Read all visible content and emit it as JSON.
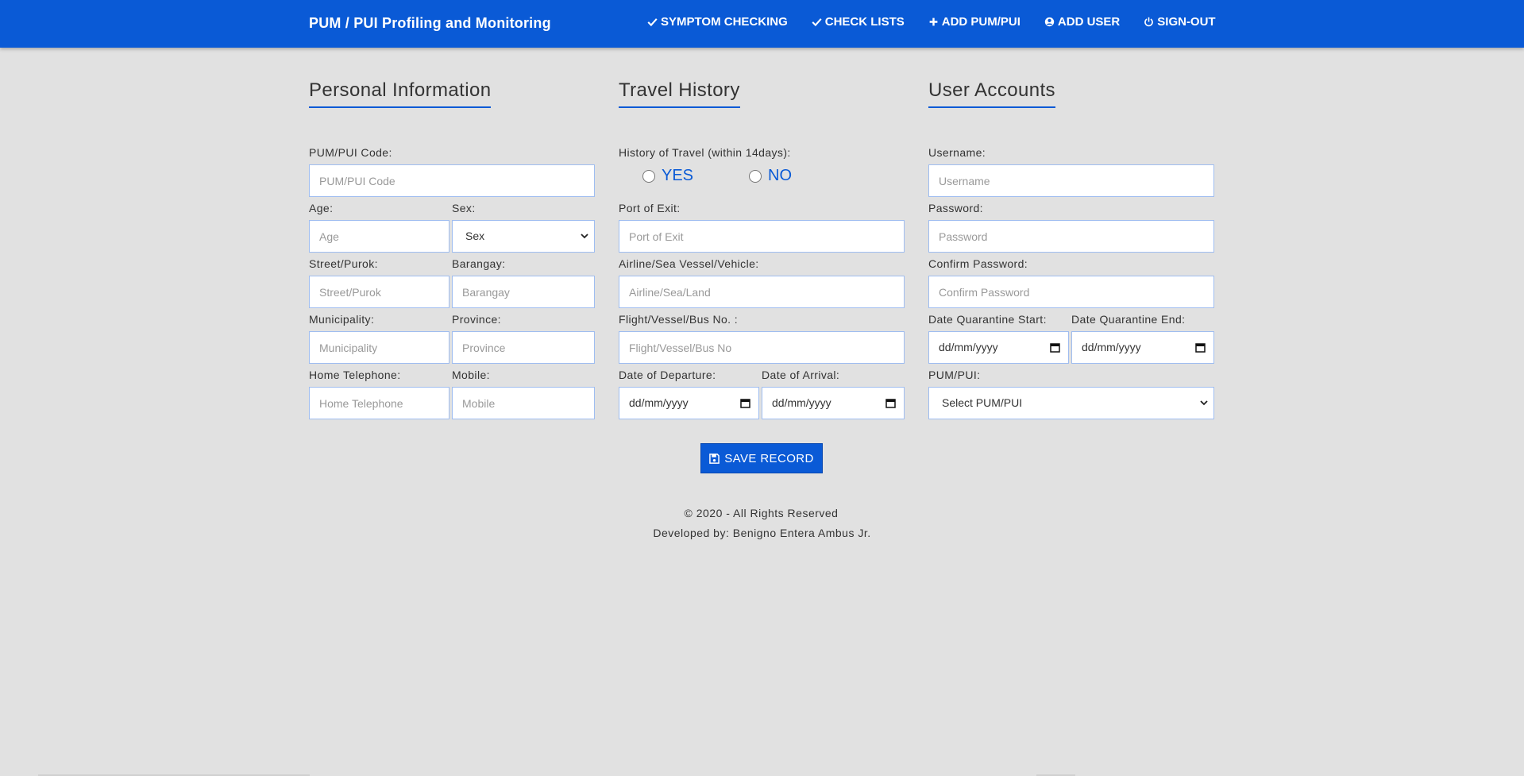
{
  "header": {
    "title": "PUM / PUI Profiling and Monitoring",
    "nav": [
      {
        "label": "SYMPTOM CHECKING",
        "icon": "check-icon"
      },
      {
        "label": "CHECK LISTS",
        "icon": "check-icon"
      },
      {
        "label": "ADD PUM/PUI",
        "icon": "plus-icon"
      },
      {
        "label": "ADD USER",
        "icon": "user-circle-icon"
      },
      {
        "label": "SIGN-OUT",
        "icon": "power-icon"
      }
    ]
  },
  "personal": {
    "title": "Personal Information",
    "code": {
      "label": "PUM/PUI Code:",
      "placeholder": "PUM/PUI Code"
    },
    "age": {
      "label": "Age:",
      "placeholder": "Age"
    },
    "sex": {
      "label": "Sex:",
      "value": "Sex"
    },
    "street": {
      "label": "Street/Purok:",
      "placeholder": "Street/Purok"
    },
    "barangay": {
      "label": "Barangay:",
      "placeholder": "Barangay"
    },
    "municipality": {
      "label": "Municipality:",
      "placeholder": "Municipality"
    },
    "province": {
      "label": "Province:",
      "placeholder": "Province"
    },
    "home_tel": {
      "label": "Home Telephone:",
      "placeholder": "Home Telephone"
    },
    "mobile": {
      "label": "Mobile:",
      "placeholder": "Mobile"
    }
  },
  "travel": {
    "title": "Travel History",
    "history": {
      "label": "History of Travel (within 14days):",
      "yes": "YES",
      "no": "NO"
    },
    "port_exit": {
      "label": "Port of Exit:",
      "placeholder": "Port of Exit"
    },
    "airline": {
      "label": "Airline/Sea Vessel/Vehicle:",
      "placeholder": "Airline/Sea/Land"
    },
    "flight_no": {
      "label": "Flight/Vessel/Bus No. :",
      "placeholder": "Flight/Vessel/Bus No"
    },
    "departure": {
      "label": "Date of Departure:",
      "value": "dd/mm/yyyy"
    },
    "arrival": {
      "label": "Date of Arrival:",
      "value": "dd/mm/yyyy"
    }
  },
  "account": {
    "title": "User Accounts",
    "username": {
      "label": "Username:",
      "placeholder": "Username"
    },
    "password": {
      "label": "Password:",
      "placeholder": "Password"
    },
    "confirm": {
      "label": "Confirm Password:",
      "placeholder": "Confirm Password"
    },
    "q_start": {
      "label": "Date Quarantine Start:",
      "value": "dd/mm/yyyy"
    },
    "q_end": {
      "label": "Date Quarantine End:",
      "value": "dd/mm/yyyy"
    },
    "pum_pui": {
      "label": "PUM/PUI:",
      "value": "Select PUM/PUI"
    }
  },
  "save_button": "SAVE RECORD",
  "footer": {
    "copyright": "© 2020 - All Rights Reserved",
    "developer": "Developed by: Benigno Entera Ambus Jr."
  },
  "colors": {
    "primary": "#0a5ad6",
    "background": "#e1e1e1",
    "input_border": "#9fbdf0"
  }
}
